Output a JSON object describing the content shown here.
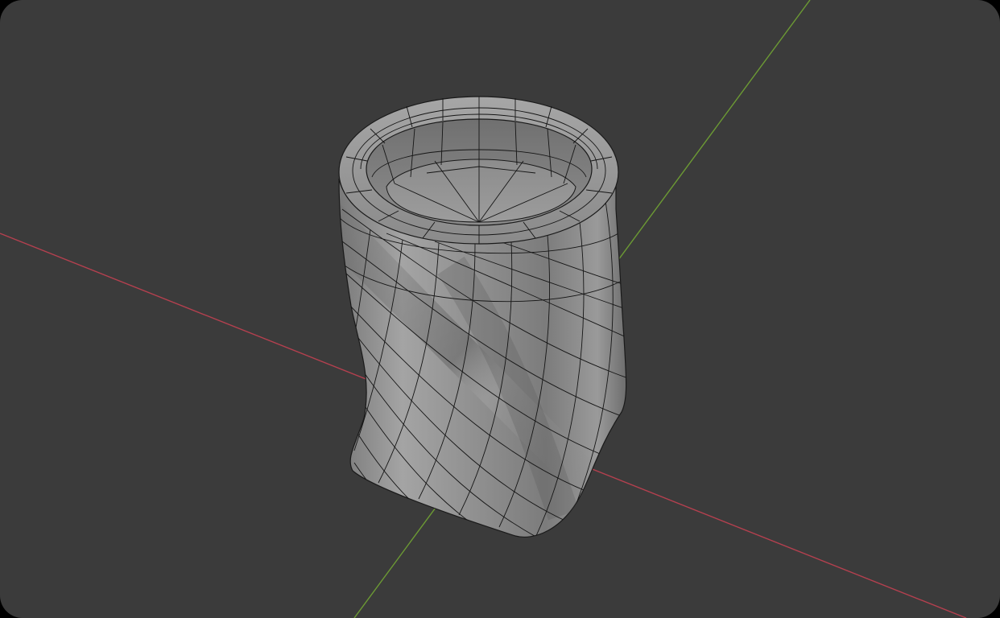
{
  "viewport": {
    "background": "#3b3b3b",
    "axis_x_color": "#b4404f",
    "axis_y_color": "#6c9a34",
    "mesh_fill": "#8f8f8f",
    "mesh_wire_color": "#151515",
    "object": "twisted-cup-icon"
  }
}
